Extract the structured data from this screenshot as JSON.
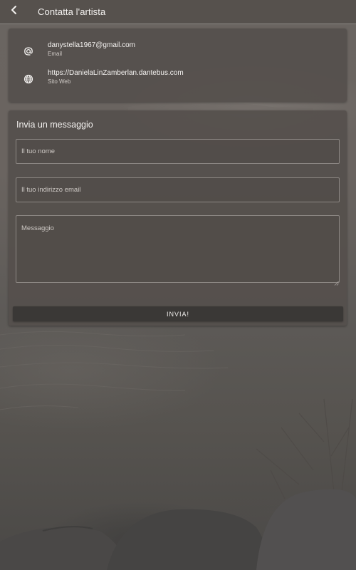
{
  "appbar": {
    "title": "Contatta l'artista",
    "back_icon": "arrow-back-icon"
  },
  "contact": {
    "items": [
      {
        "icon": "at-icon",
        "value": "danystella1967@gmail.com",
        "label": "Email"
      },
      {
        "icon": "globe-icon",
        "value": "https://DanielaLinZamberlan.dantebus.com",
        "label": "Sito Web"
      }
    ]
  },
  "form": {
    "title": "Invia un messaggio",
    "name_placeholder": "Il tuo nome",
    "email_placeholder": "Il tuo indirizzo email",
    "message_placeholder": "Messaggio",
    "name_value": "",
    "email_value": "",
    "message_value": "",
    "submit_label": "INVIA!"
  },
  "colors": {
    "appbar": "#56514d",
    "card": "#55504c",
    "button": "#3a3836",
    "text": "#f4f2f0"
  }
}
